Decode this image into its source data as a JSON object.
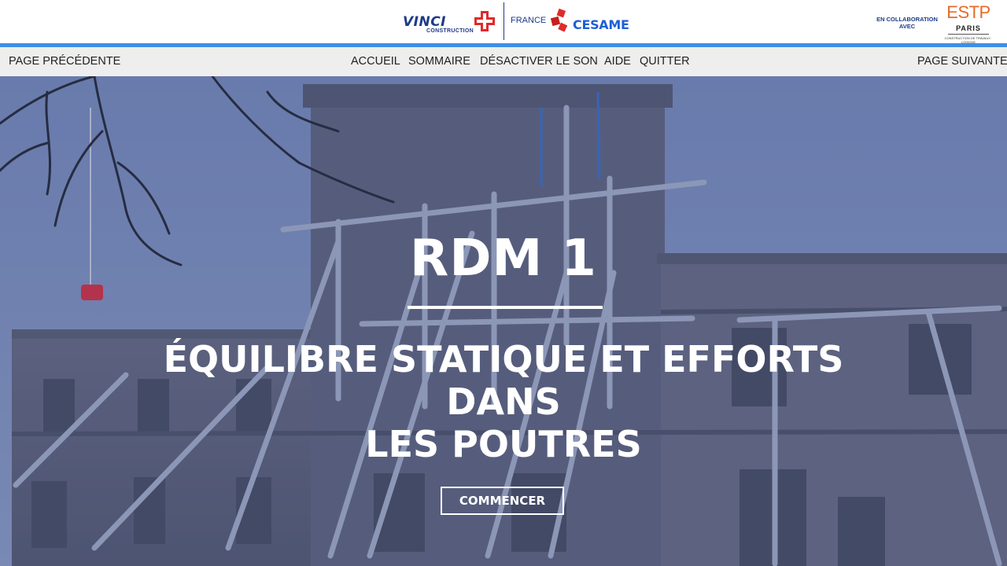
{
  "header": {
    "vinci_name": "VINCI",
    "vinci_sub": "CONSTRUCTION",
    "france": "FRANCE",
    "cesame": "CESAME",
    "collab_line1": "EN COLLABORATION",
    "collab_line2": "AVEC",
    "estp_name": "ESTP",
    "estp_city": "PARIS",
    "estp_tagline": "CONSTRUCTION DE TRAVAUX · LOGIQUE"
  },
  "nav": {
    "prev": "PAGE PRÉCÉDENTE",
    "home": "ACCUEIL",
    "summary": "SOMMAIRE",
    "mute": "DÉSACTIVER LE SON",
    "help": "AIDE",
    "quit": "QUITTER",
    "next": "PAGE SUIVANTE"
  },
  "hero": {
    "title": "RDM 1",
    "subtitle_line1": "ÉQUILIBRE STATIQUE ET EFFORTS DANS",
    "subtitle_line2": "LES POUTRES",
    "start": "COMMENCER"
  },
  "colors": {
    "accent_blue": "#3f8ee6",
    "brand_navy": "#1e3b8a",
    "brand_red": "#e02a2a",
    "estp_orange": "#e66a2a"
  }
}
